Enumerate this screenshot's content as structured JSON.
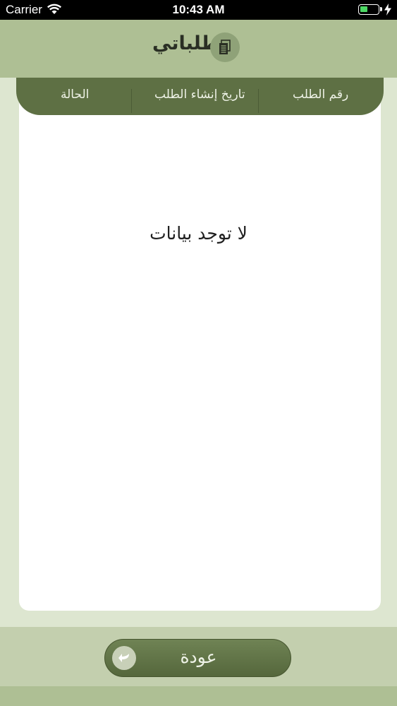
{
  "status_bar": {
    "carrier": "Carrier",
    "time": "10:43 AM",
    "battery_level": 0.4
  },
  "header": {
    "title": "طلباتي",
    "icon": "document-icon"
  },
  "table": {
    "columns": [
      "رقم الطلب",
      "تاريخ إنشاء الطلب",
      "الحالة"
    ],
    "rows": [],
    "empty_message": "لا توجد بيانات"
  },
  "footer": {
    "back_label": "عودة",
    "back_icon": "back-arrow-icon"
  },
  "colors": {
    "header_bg": "#aebf94",
    "table_header_bg": "#5e7044",
    "button_bg": "#5f7145"
  }
}
